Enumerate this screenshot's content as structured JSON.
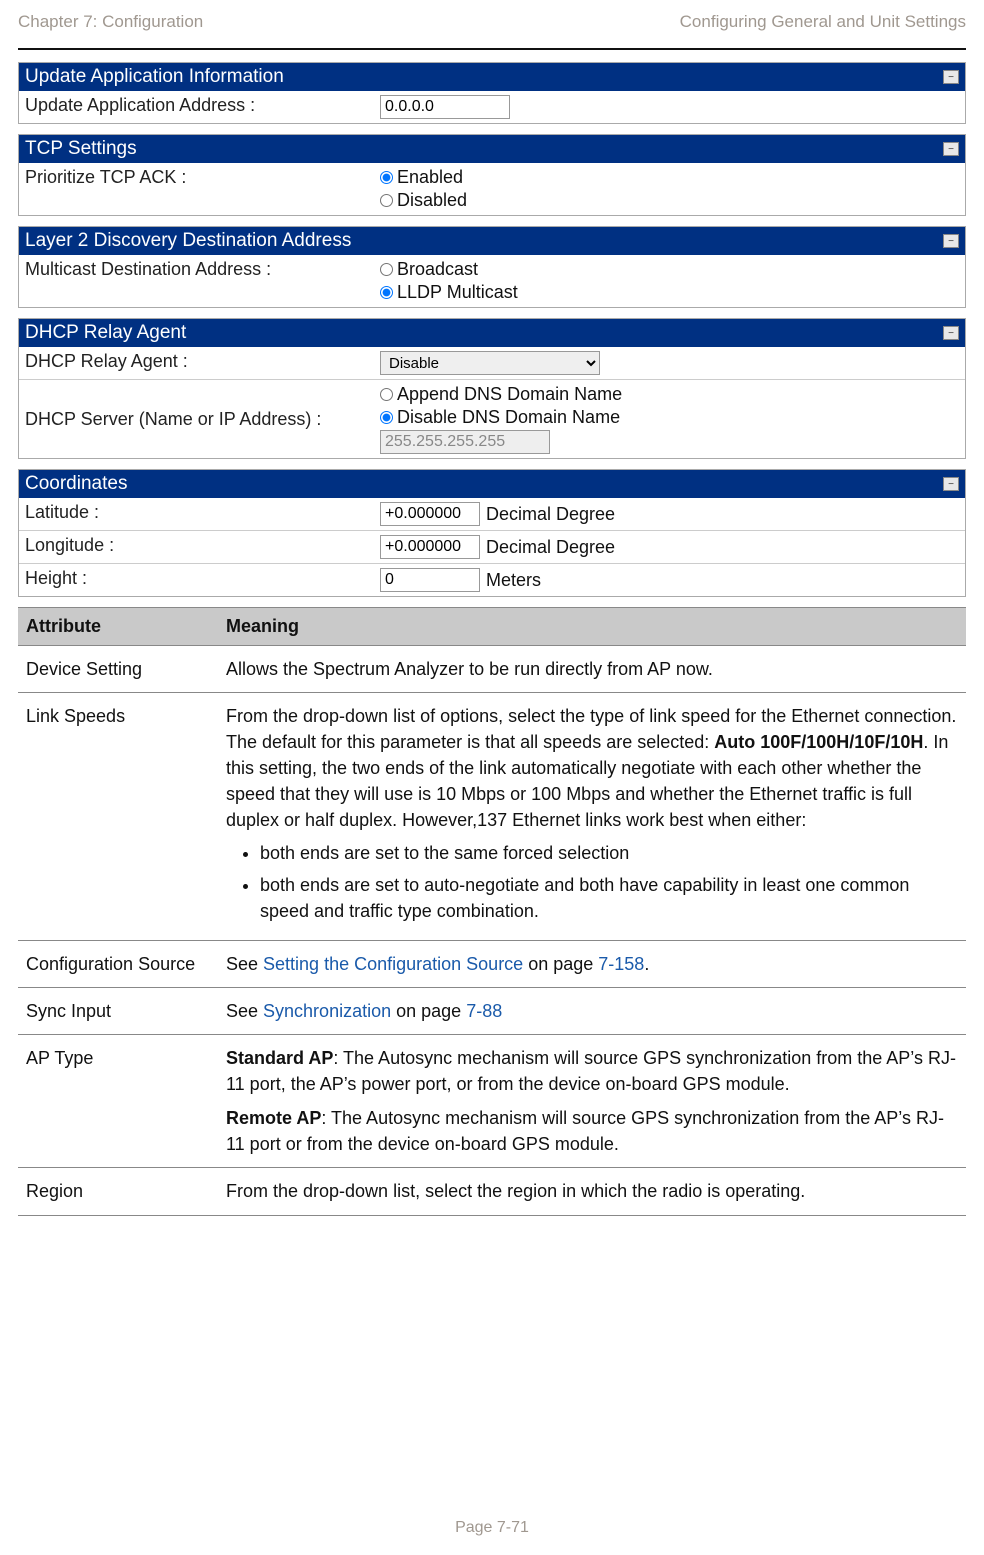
{
  "header": {
    "left": "Chapter 7:  Configuration",
    "right": "Configuring General and Unit Settings"
  },
  "panels": {
    "update": {
      "title": "Update Application Information",
      "label": "Update Application Address :",
      "value": "0.0.0.0"
    },
    "tcp": {
      "title": "TCP Settings",
      "label": "Prioritize TCP ACK :",
      "opt1": "Enabled",
      "opt2": "Disabled"
    },
    "layer2": {
      "title": "Layer 2 Discovery Destination Address",
      "label": "Multicast Destination Address :",
      "opt1": "Broadcast",
      "opt2": "LLDP Multicast"
    },
    "dhcp": {
      "title": "DHCP Relay Agent",
      "row1label": "DHCP Relay Agent :",
      "row1value": "Disable",
      "row2label": "DHCP Server (Name or IP Address) :",
      "opt1": "Append DNS Domain Name",
      "opt2": "Disable DNS Domain Name",
      "ip": "255.255.255.255"
    },
    "coords": {
      "title": "Coordinates",
      "latlabel": "Latitude :",
      "latval": "+0.000000",
      "latunit": "Decimal Degree",
      "lonlabel": "Longitude :",
      "lonval": "+0.000000",
      "lonunit": "Decimal Degree",
      "hlabel": "Height :",
      "hval": "0",
      "hunit": "Meters"
    }
  },
  "table": {
    "h1": "Attribute",
    "h2": "Meaning",
    "rows": {
      "device": {
        "attr": "Device Setting",
        "meaning": "Allows the Spectrum Analyzer to be run directly from AP now."
      },
      "link": {
        "attr": "Link Speeds",
        "p1a": "From the drop-down list of options, select the type of link speed for the Ethernet connection. The default for this parameter is that all speeds are selected: ",
        "p1bold": "Auto 100F/100H/10F/10H",
        "p1b": ". In this setting, the two ends of the link automatically negotiate with each other whether the speed that they will use is 10 Mbps or 100 Mbps and whether the Ethernet traffic is full duplex or half duplex. However,137 Ethernet links work best when either:",
        "li1": "both ends are set to the same forced selection",
        "li2": "both ends are set to auto-negotiate and both have capability in least one common speed and traffic type combination."
      },
      "config": {
        "attr": "Configuration Source",
        "pre": "See ",
        "link": "Setting the Configuration Source",
        "mid": " on page ",
        "page": "7-158",
        "post": "."
      },
      "sync": {
        "attr": "Sync Input",
        "pre": "See ",
        "link": "Synchronization",
        "mid": " on page ",
        "page": "7-88"
      },
      "ap": {
        "attr": "AP Type",
        "s1bold": "Standard AP",
        "s1": ":  The Autosync mechanism will source GPS synchronization from the AP’s RJ-11 port, the AP’s power port, or from the device on-board GPS module.",
        "s2bold": "Remote AP",
        "s2": ":  The Autosync mechanism will source GPS synchronization from the AP’s RJ-11 port or from the device on-board GPS module."
      },
      "region": {
        "attr": "Region",
        "meaning": "From the drop-down list, select the region in which the radio is operating."
      }
    }
  },
  "footer": "Page 7-71"
}
